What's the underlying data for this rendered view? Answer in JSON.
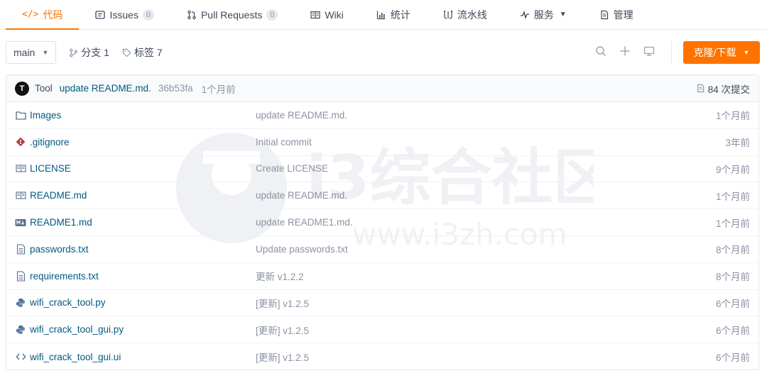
{
  "nav": {
    "tabs": [
      {
        "label": "代码",
        "icon": "</>"
      },
      {
        "label": "Issues",
        "badge": "0"
      },
      {
        "label": "Pull Requests",
        "badge": "0"
      },
      {
        "label": "Wiki"
      },
      {
        "label": "统计"
      },
      {
        "label": "流水线"
      },
      {
        "label": "服务"
      },
      {
        "label": "管理"
      }
    ]
  },
  "toolbar": {
    "branch": "main",
    "branches_label": "分支 1",
    "tags_label": "标签 7",
    "clone_label": "克隆/下载"
  },
  "commit": {
    "avatar_letter": "T",
    "author": "Tool",
    "message": "update README.md.",
    "sha": "36b53fa",
    "time": "1个月前",
    "count_label": "84 次提交"
  },
  "files": [
    {
      "name": "Images",
      "icon": "folder-icon",
      "message": "update README.md.",
      "time": "1个月前"
    },
    {
      "name": ".gitignore",
      "icon": "git-icon",
      "message": "Initial commit",
      "time": "3年前"
    },
    {
      "name": "LICENSE",
      "icon": "license-icon",
      "message": "Create LICENSE",
      "time": "9个月前"
    },
    {
      "name": "README.md",
      "icon": "book-icon",
      "message": "update README.md.",
      "time": "1个月前"
    },
    {
      "name": "README1.md",
      "icon": "markdown-icon",
      "message": "update README1.md.",
      "time": "1个月前"
    },
    {
      "name": "passwords.txt",
      "icon": "text-file-icon",
      "message": "Update passwords.txt",
      "time": "8个月前"
    },
    {
      "name": "requirements.txt",
      "icon": "text-file-icon",
      "message": "更新 v1.2.2",
      "time": "8个月前"
    },
    {
      "name": "wifi_crack_tool.py",
      "icon": "python-icon",
      "message": "[更新] v1.2.5",
      "time": "6个月前"
    },
    {
      "name": "wifi_crack_tool_gui.py",
      "icon": "python-icon",
      "message": "[更新] v1.2.5",
      "time": "6个月前"
    },
    {
      "name": "wifi_crack_tool_gui.ui",
      "icon": "code-icon",
      "message": "[更新] v1.2.5",
      "time": "6个月前"
    }
  ],
  "watermark": {
    "text": "i3综合社区",
    "url": "www.i3zh.com"
  },
  "colors": {
    "accent": "#fe7300",
    "link": "#005980",
    "muted": "#8c92a4"
  }
}
